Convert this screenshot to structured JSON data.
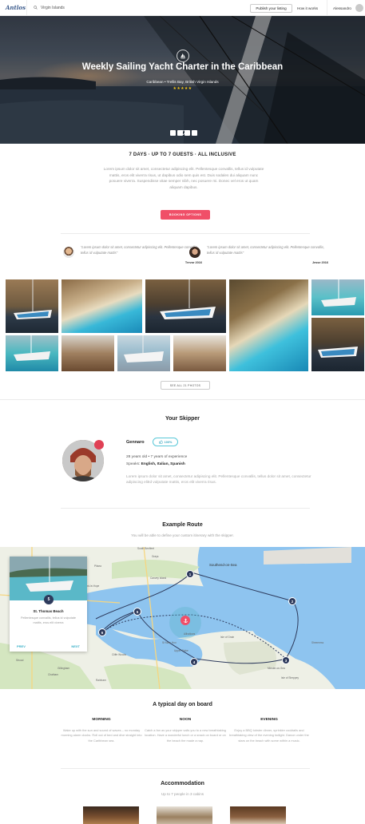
{
  "nav": {
    "logo": "Antlos",
    "search_value": "Virgin Islands",
    "publish_label": "Publish your listing",
    "how_label": "How it works",
    "user_name": "Alessandro"
  },
  "hero": {
    "title": "Weekly Sailing Yacht Charter in the Caribbean",
    "subtitle": "Caribbean • Trellis Bay, British Virgin Islands",
    "stars": "★★★★★"
  },
  "intro": {
    "features": "7 DAYS  ·  UP TO 7 GUESTS  ·  ALL INCLUSIVE",
    "text": "Lorem ipsum dolor sit amet, consectetur adipiscing elit. Pellentesque convallis, tellus id vulputate mattis, eros elit viverra risus, ut dapibus odio sem quis est. Duis sodales dui aliquam nunc posuere viverra. Suspendisse vitae semper nibh, nec posuere mi. Donec vel eros ut quam aliquam dapibus.",
    "booking_label": "BOOKING OPTIONS"
  },
  "testimonials": [
    {
      "quote": "“Lorem ipsum dolor sit amet, consectetur adipiscing elit. Pellentesque convallis, tellus id vulputate mattis”",
      "author": "Trevor 2016"
    },
    {
      "quote": "“Lorem ipsum dolor sit amet, consectetur adipiscing elit. Pellentesque convallis, tellus id vulputate mattis”",
      "author": "Jesse 2016"
    }
  ],
  "gallery": {
    "see_all_label": "SEE ALL 21 PHOTOS"
  },
  "skipper": {
    "section_title": "Your Skipper",
    "name": "Gennaro",
    "rating": "100%",
    "info": "28 years old • 7 years of experience",
    "speaks_label": "Speaks: ",
    "languages": "English, Italian, Spanish",
    "bio": "Lorem ipsum dolor sit amet, consectetur adipiscing elit. Pellentesque convallis, tellus dolor sit amet, consectetur adipiscing elitId vulputate mattis, eros elit viverra risus."
  },
  "route": {
    "section_title": "Example Route",
    "subtitle": "You will be able to define your custom itinerary with the skipper.",
    "card_number": "5",
    "card_title": "St. Thomas Beach",
    "card_desc": "Pellentesque convallis, tellus id vulputate mattis, eros elit viverra",
    "prev_label": "PREV",
    "next_label": "NEXT",
    "map_labels": [
      "South Benfleet",
      "Southend-on-Sea",
      "Pitsea",
      "Canvey Island",
      "Stanford-le-Hope",
      "Allhallows",
      "St Mary Hoo",
      "Upper Stoke",
      "Isle of Grain",
      "Minster-on-Sea",
      "Isle of Sheppey",
      "Gillingham",
      "Chatham",
      "Rainham",
      "Strood",
      "Cliffe Woods",
      "Grays",
      "Sheerness"
    ],
    "stops": [
      "1",
      "2",
      "3",
      "4",
      "5",
      "6"
    ]
  },
  "day": {
    "section_title": "A typical day on board",
    "columns": [
      {
        "title": "MORNING",
        "text": "Wake up with the sun and sound of waves – no monday morning alarm clocks. Roll out of bed and dive straight into the Caribbean sea."
      },
      {
        "title": "NOON",
        "text": "Catch a fan as your skipper sails you to a new breathtaking location. Have a wonderful lunch or a snack on board or on the beach the made a nap."
      },
      {
        "title": "EVENING",
        "text": "Enjoy a BBQ lobster dinner, sprinkler cocktails and breathtaking view of the evening twilight. Dance under the stars on the beach with some within a music."
      }
    ]
  },
  "accommodation": {
    "section_title": "Accommodation",
    "subtitle": "Up to 7 people in 3 cabins"
  },
  "colors": {
    "accent": "#f04f68",
    "teal": "#3ab0c8",
    "navy": "#2d3a5c",
    "sea": "#5aa8e0"
  }
}
